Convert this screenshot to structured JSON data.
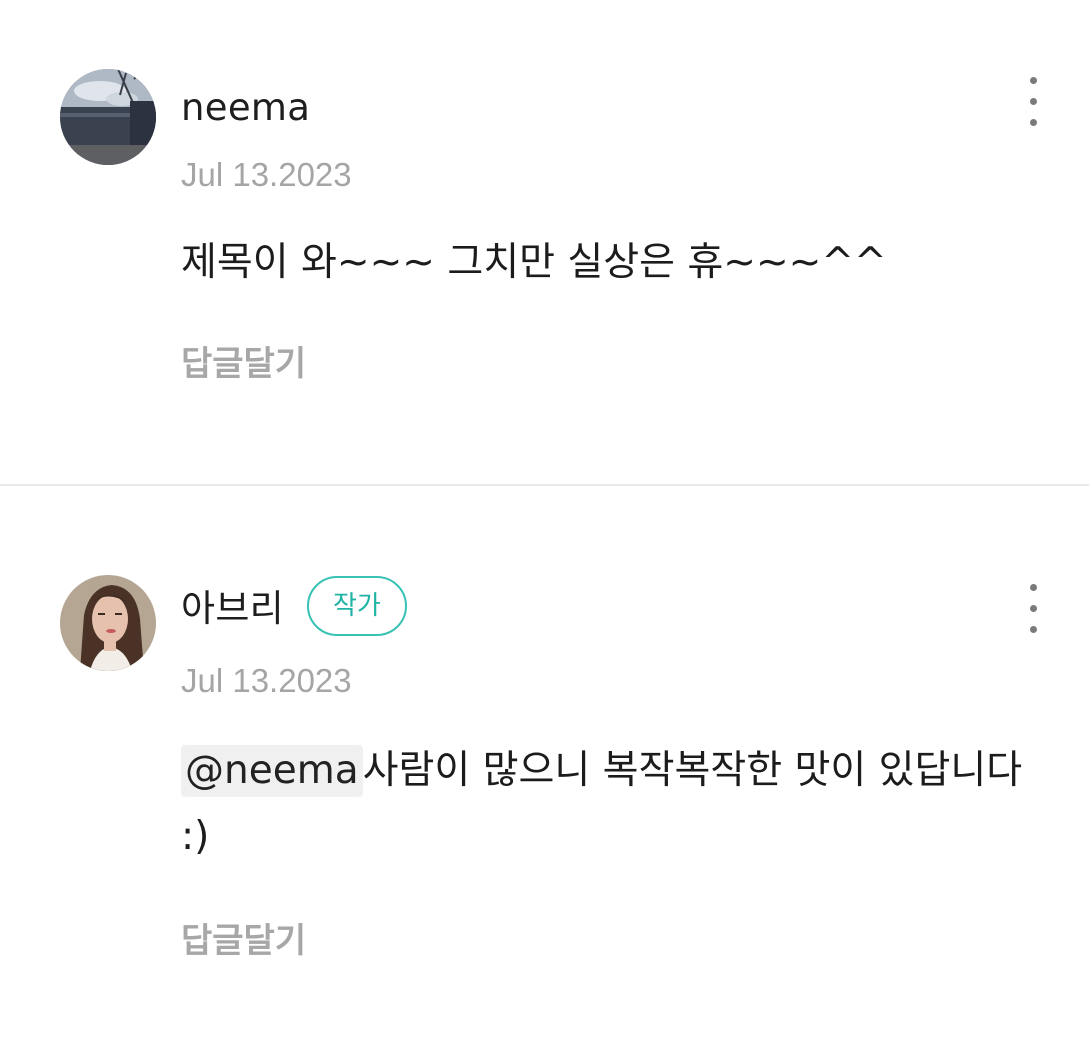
{
  "comments": [
    {
      "username": "neema",
      "date": "Jul 13.2023",
      "text": "제목이 와~~~ 그치만 실상은 휴~~~^^",
      "reply_label": "답글달기",
      "more_icon": "vertical-ellipsis-icon"
    },
    {
      "username": "아브리",
      "badge": "작가",
      "date": "Jul 13.2023",
      "mention": "@neema",
      "text": "사람이 많으니 복작복작한 맛이 있답니다 :)",
      "reply_label": "답글달기",
      "more_icon": "vertical-ellipsis-icon"
    }
  ],
  "colors": {
    "badge_accent": "#37c2b4",
    "date_gray": "#a5a5a5",
    "divider": "#e9e9e9"
  }
}
